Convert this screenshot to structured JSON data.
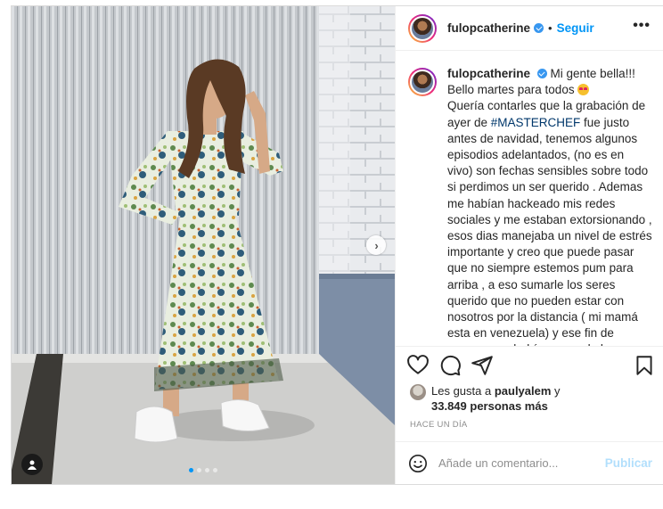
{
  "post": {
    "username": "fulopcatherine",
    "follow_label": "Seguir",
    "separator": "•",
    "more_label": "•••",
    "photo": {
      "carousel_total": 4,
      "carousel_active": 1,
      "next_icon": "chevron-right-icon"
    },
    "caption": {
      "username": "fulopcatherine",
      "text_part1": "Mi gente bella!!! Bello martes para todos ",
      "emoji": "heart-eyes-emoji",
      "text_part2": "Quería contarles que la grabación de ayer de ",
      "hashtag": "#MASTERCHEF",
      "text_part3": " fue justo antes de navidad, tenemos algunos episodios adelantados, (no es en vivo) son fechas sensibles sobre todo si perdimos un ser querido . Ademas me habían hackeado mis redes sociales y me estaban extorsionando , esos dias manejaba un nivel de estrés importante y creo que puede pasar que no siempre estemos pum para arriba , a eso sumarle los seres querido que no pueden estar con nosotros por la distancia ( mi mamá esta en venezuela) y ese fin de semana me había quemado la mano para"
    },
    "actions": {
      "like_icon": "heart-icon",
      "comment_icon": "comment-icon",
      "share_icon": "send-icon",
      "save_icon": "bookmark-icon"
    },
    "likes": {
      "prefix": "Les gusta a ",
      "first_user": "paulyalem",
      "connector": " y",
      "others": "33.849 personas más"
    },
    "timestamp": "HACE UN DÍA",
    "comment": {
      "placeholder": "Añade un comentario...",
      "publish_label": "Publicar",
      "emoji_icon": "smiley-icon"
    }
  }
}
